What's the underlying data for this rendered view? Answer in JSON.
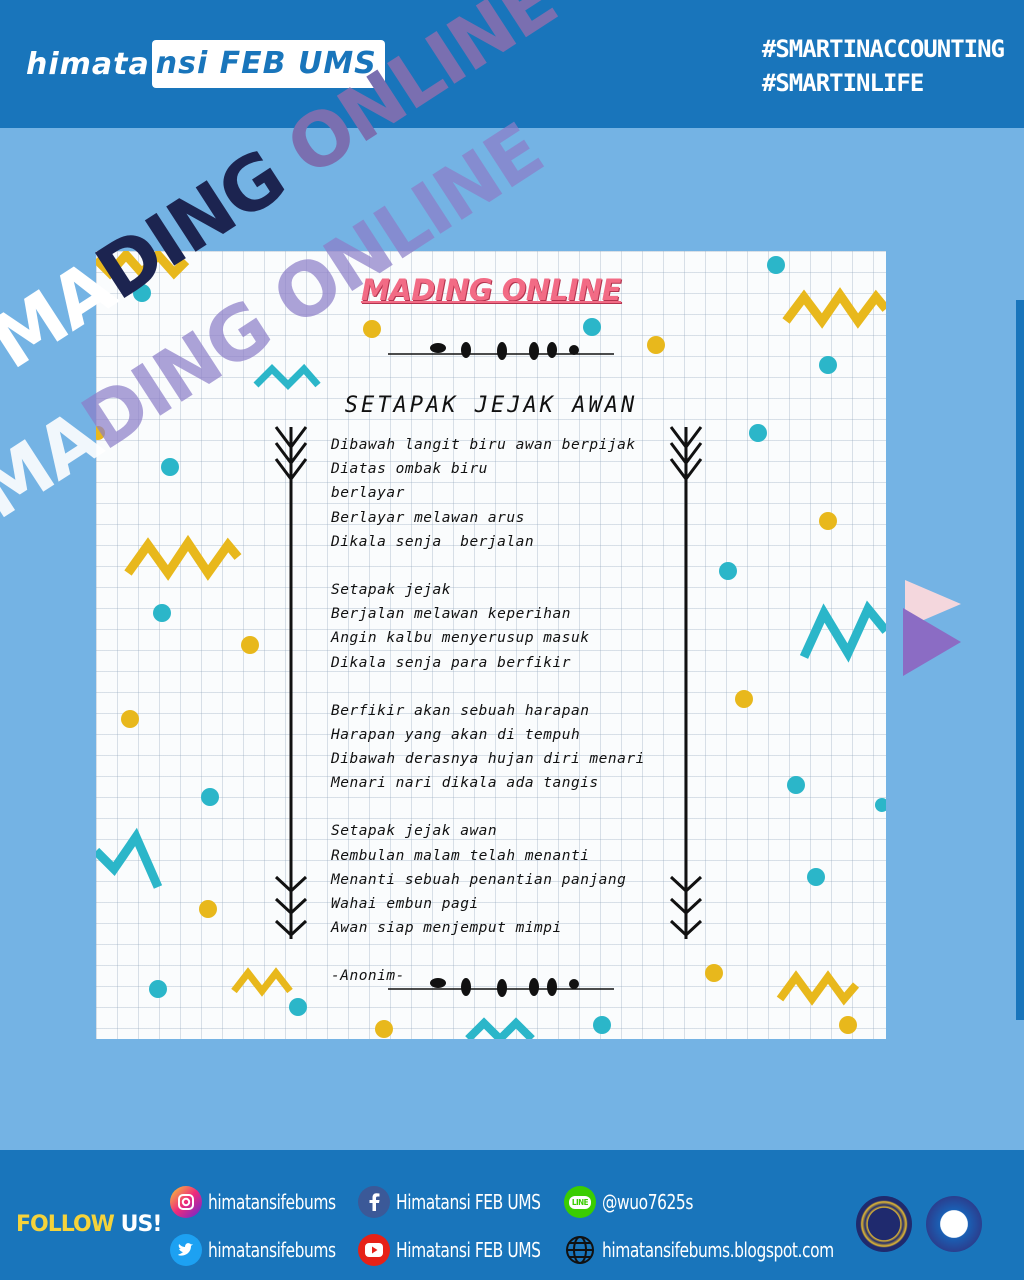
{
  "header": {
    "logo_left": "himata",
    "logo_right": "nsi FEB UMS",
    "tags": [
      "#SMARTINACCOUNTING",
      "#SMARTINLIFE"
    ]
  },
  "overlay": {
    "line1_a": "MA",
    "line1_b": "DING ",
    "line1_c": "ONLINE",
    "line2_a": "MA",
    "line2_b": "DING ",
    "line2_c": "ONLINE"
  },
  "poster": {
    "title": "MADING ONLINE",
    "poem_title": "SETAPAK JEJAK AWAN",
    "stanzas": [
      [
        "Dibawah langit biru awan berpijak",
        "Diatas ombak biru",
        "berlayar",
        "Berlayar melawan arus",
        "Dikala senja  berjalan"
      ],
      [
        "Setapak jejak",
        "Berjalan melawan keperihan",
        "Angin kalbu menyerusup masuk",
        "Dikala senja para berfikir"
      ],
      [
        "Berfikir akan sebuah harapan",
        "Harapan yang akan di tempuh",
        "Dibawah derasnya hujan diri menari",
        "Menari nari dikala ada tangis"
      ],
      [
        "Setapak jejak awan",
        "Rembulan malam telah menanti",
        "Menanti sebuah penantian panjang",
        "Wahai embun pagi",
        "Awan siap menjemput mimpi"
      ]
    ],
    "author": "-Anonim-"
  },
  "footer": {
    "follow_a": "FOLLOW ",
    "follow_b": "US!",
    "instagram": "himatansifebums",
    "twitter": "himatansifebums",
    "facebook": "Himatansi FEB UMS",
    "youtube": "Himatansi FEB UMS",
    "line": "@wuo7625s",
    "line_icon_text": "LINE",
    "website": "himatansifebums.blogspot.com"
  },
  "colors": {
    "header_blue": "#1975bb",
    "background": "#74b3e4",
    "title_pink": "#f26b85",
    "accent_yellow": "#e8b81c",
    "accent_teal": "#2bb6c9"
  }
}
